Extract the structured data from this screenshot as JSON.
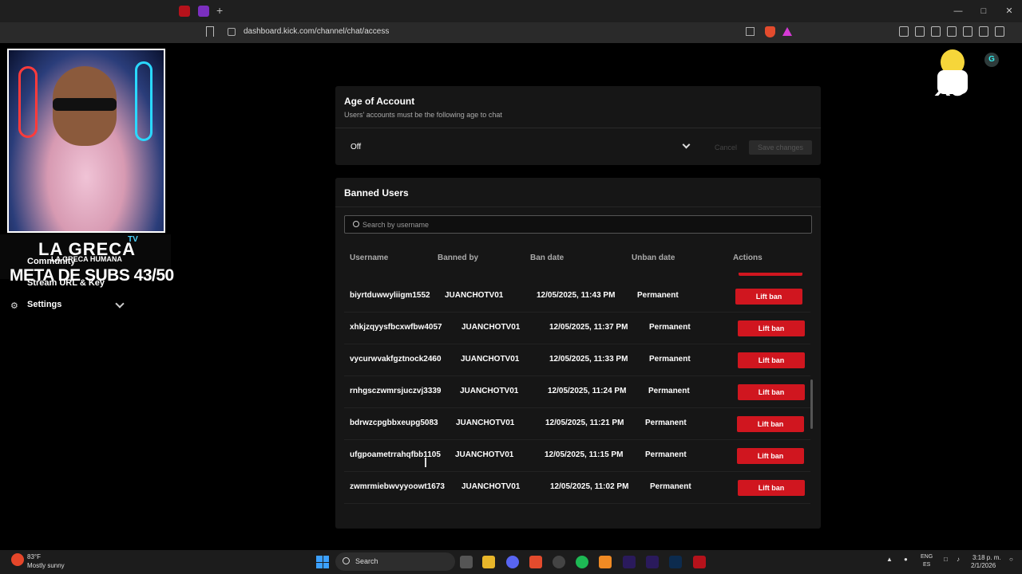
{
  "browser": {
    "url": "dashboard.kick.com/channel/chat/access"
  },
  "overlay": {
    "brand": "LA GRECA",
    "brand_sub": "LA GRECA HUMANA",
    "brand_tv": "TV",
    "meta": "META DE SUBS 43/50",
    "sticker_text": "X5",
    "badge": "G"
  },
  "sidebar": {
    "items": [
      {
        "label": "Community"
      },
      {
        "label": "Stream URL & Key"
      },
      {
        "label": "Settings"
      }
    ]
  },
  "age_of_account": {
    "title": "Age of Account",
    "description": "Users' accounts must be the following age to chat",
    "selected": "Off",
    "cancel_label": "Cancel",
    "save_label": "Save changes"
  },
  "banned_users": {
    "title": "Banned Users",
    "search_placeholder": "Search by username",
    "columns": [
      "Username",
      "Banned by",
      "Ban date",
      "Unban date",
      "Actions"
    ],
    "action_label": "Lift ban",
    "rows": [
      {
        "username": "biyrtduwwyliigm1552",
        "banned_by": "JUANCHOTV01",
        "ban_date": "12/05/2025, 11:43 PM",
        "unban_date": "Permanent"
      },
      {
        "username": "xhkjzqyysfbcxwfbw4057",
        "banned_by": "JUANCHOTV01",
        "ban_date": "12/05/2025, 11:37 PM",
        "unban_date": "Permanent"
      },
      {
        "username": "vycurwvakfgztnock2460",
        "banned_by": "JUANCHOTV01",
        "ban_date": "12/05/2025, 11:33 PM",
        "unban_date": "Permanent"
      },
      {
        "username": "rnhgsczwmrsjuczvj3339",
        "banned_by": "JUANCHOTV01",
        "ban_date": "12/05/2025, 11:24 PM",
        "unban_date": "Permanent"
      },
      {
        "username": "bdrwzcpgbbxeupg5083",
        "banned_by": "JUANCHOTV01",
        "ban_date": "12/05/2025, 11:21 PM",
        "unban_date": "Permanent"
      },
      {
        "username": "ufgpoametrrahqfbb1105",
        "banned_by": "JUANCHOTV01",
        "ban_date": "12/05/2025, 11:15 PM",
        "unban_date": "Permanent"
      },
      {
        "username": "zwmrmiebwvyyoowt1673",
        "banned_by": "JUANCHOTV01",
        "ban_date": "12/05/2025, 11:02 PM",
        "unban_date": "Permanent"
      }
    ]
  },
  "taskbar": {
    "temperature": "83°F",
    "weather": "Mostly sunny",
    "search_label": "Search",
    "lang": "ENG",
    "lang_sub": "ES",
    "time": "3:18 p. m.",
    "date": "2/1/2026"
  },
  "colors": {
    "accent_red": "#d0161f",
    "fab_green": "#15c15a"
  }
}
